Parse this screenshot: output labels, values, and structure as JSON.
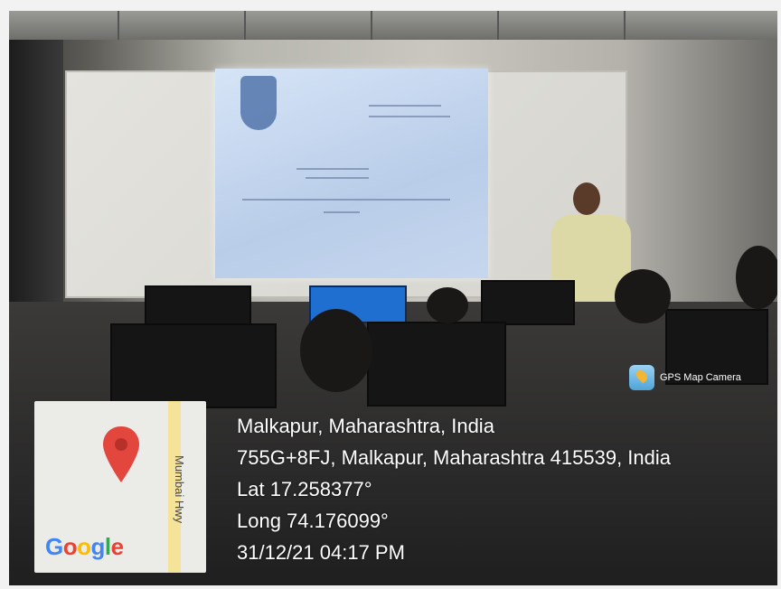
{
  "watermark": {
    "app_name": "GPS Map Camera",
    "place": "Malkapur, Maharashtra, India",
    "address": "755G+8FJ, Malkapur, Maharashtra 415539, India",
    "latitude": "Lat 17.258377°",
    "longitude": "Long 74.176099°",
    "datetime": "31/12/21 04:17 PM"
  },
  "map": {
    "road_label": "Mumbai Hwy",
    "logo_text": "Google",
    "pin_color": "#e2463c"
  },
  "colors": {
    "caption_text": "#ffffff",
    "projector_screen": "#c8d8ef",
    "blue_monitor": "#1f6fd0"
  }
}
